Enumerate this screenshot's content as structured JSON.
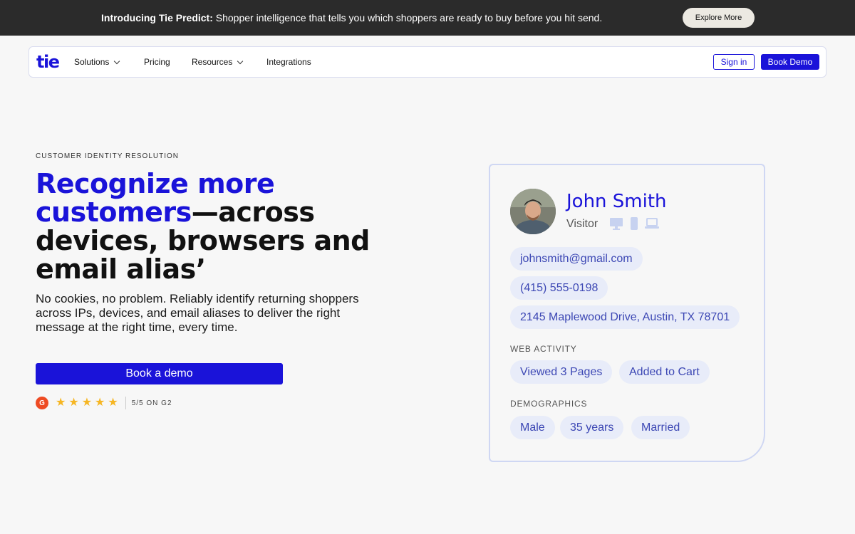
{
  "announcement": {
    "lead": "Introducing Tie Predict:",
    "text": " Shopper intelligence that tells you which shoppers are ready to buy before you hit send.",
    "button": "Explore More"
  },
  "nav": {
    "logo": "tie",
    "items": [
      {
        "label": "Solutions",
        "has_dropdown": true
      },
      {
        "label": "Pricing",
        "has_dropdown": false
      },
      {
        "label": "Resources",
        "has_dropdown": true
      },
      {
        "label": "Integrations",
        "has_dropdown": false
      }
    ],
    "sign_in": "Sign in",
    "book_demo": "Book Demo"
  },
  "hero": {
    "eyebrow": "CUSTOMER IDENTITY RESOLUTION",
    "headline_blue": "Recognize more customers",
    "headline_rest": "—across devices, browsers and email alias’",
    "subtext": "No cookies, no problem. Reliably identify returning shoppers across IPs, devices, and email aliases to deliver the right message at the right time, every time.",
    "cta": "Book a demo",
    "rating": {
      "badge": "G",
      "stars": 5,
      "text": "5/5 ON G2"
    }
  },
  "profile": {
    "name": "John Smith",
    "status": "Visitor",
    "device_icons": [
      "desktop-icon",
      "phone-icon",
      "laptop-icon"
    ],
    "contact": [
      "johnsmith@gmail.com",
      "(415) 555-0198",
      "2145 Maplewood Drive, Austin, TX 78701"
    ],
    "web_activity_label": "WEB ACTIVITY",
    "web_activity": [
      "Viewed 3 Pages",
      "Added to Cart"
    ],
    "demographics_label": "DEMOGRAPHICS",
    "demographics": [
      "Male",
      "35 years",
      "Married"
    ]
  },
  "colors": {
    "brand": "#1a13d9",
    "pill_bg": "#e8ecf9",
    "pill_text": "#3c47b4",
    "star": "#f6b623"
  }
}
